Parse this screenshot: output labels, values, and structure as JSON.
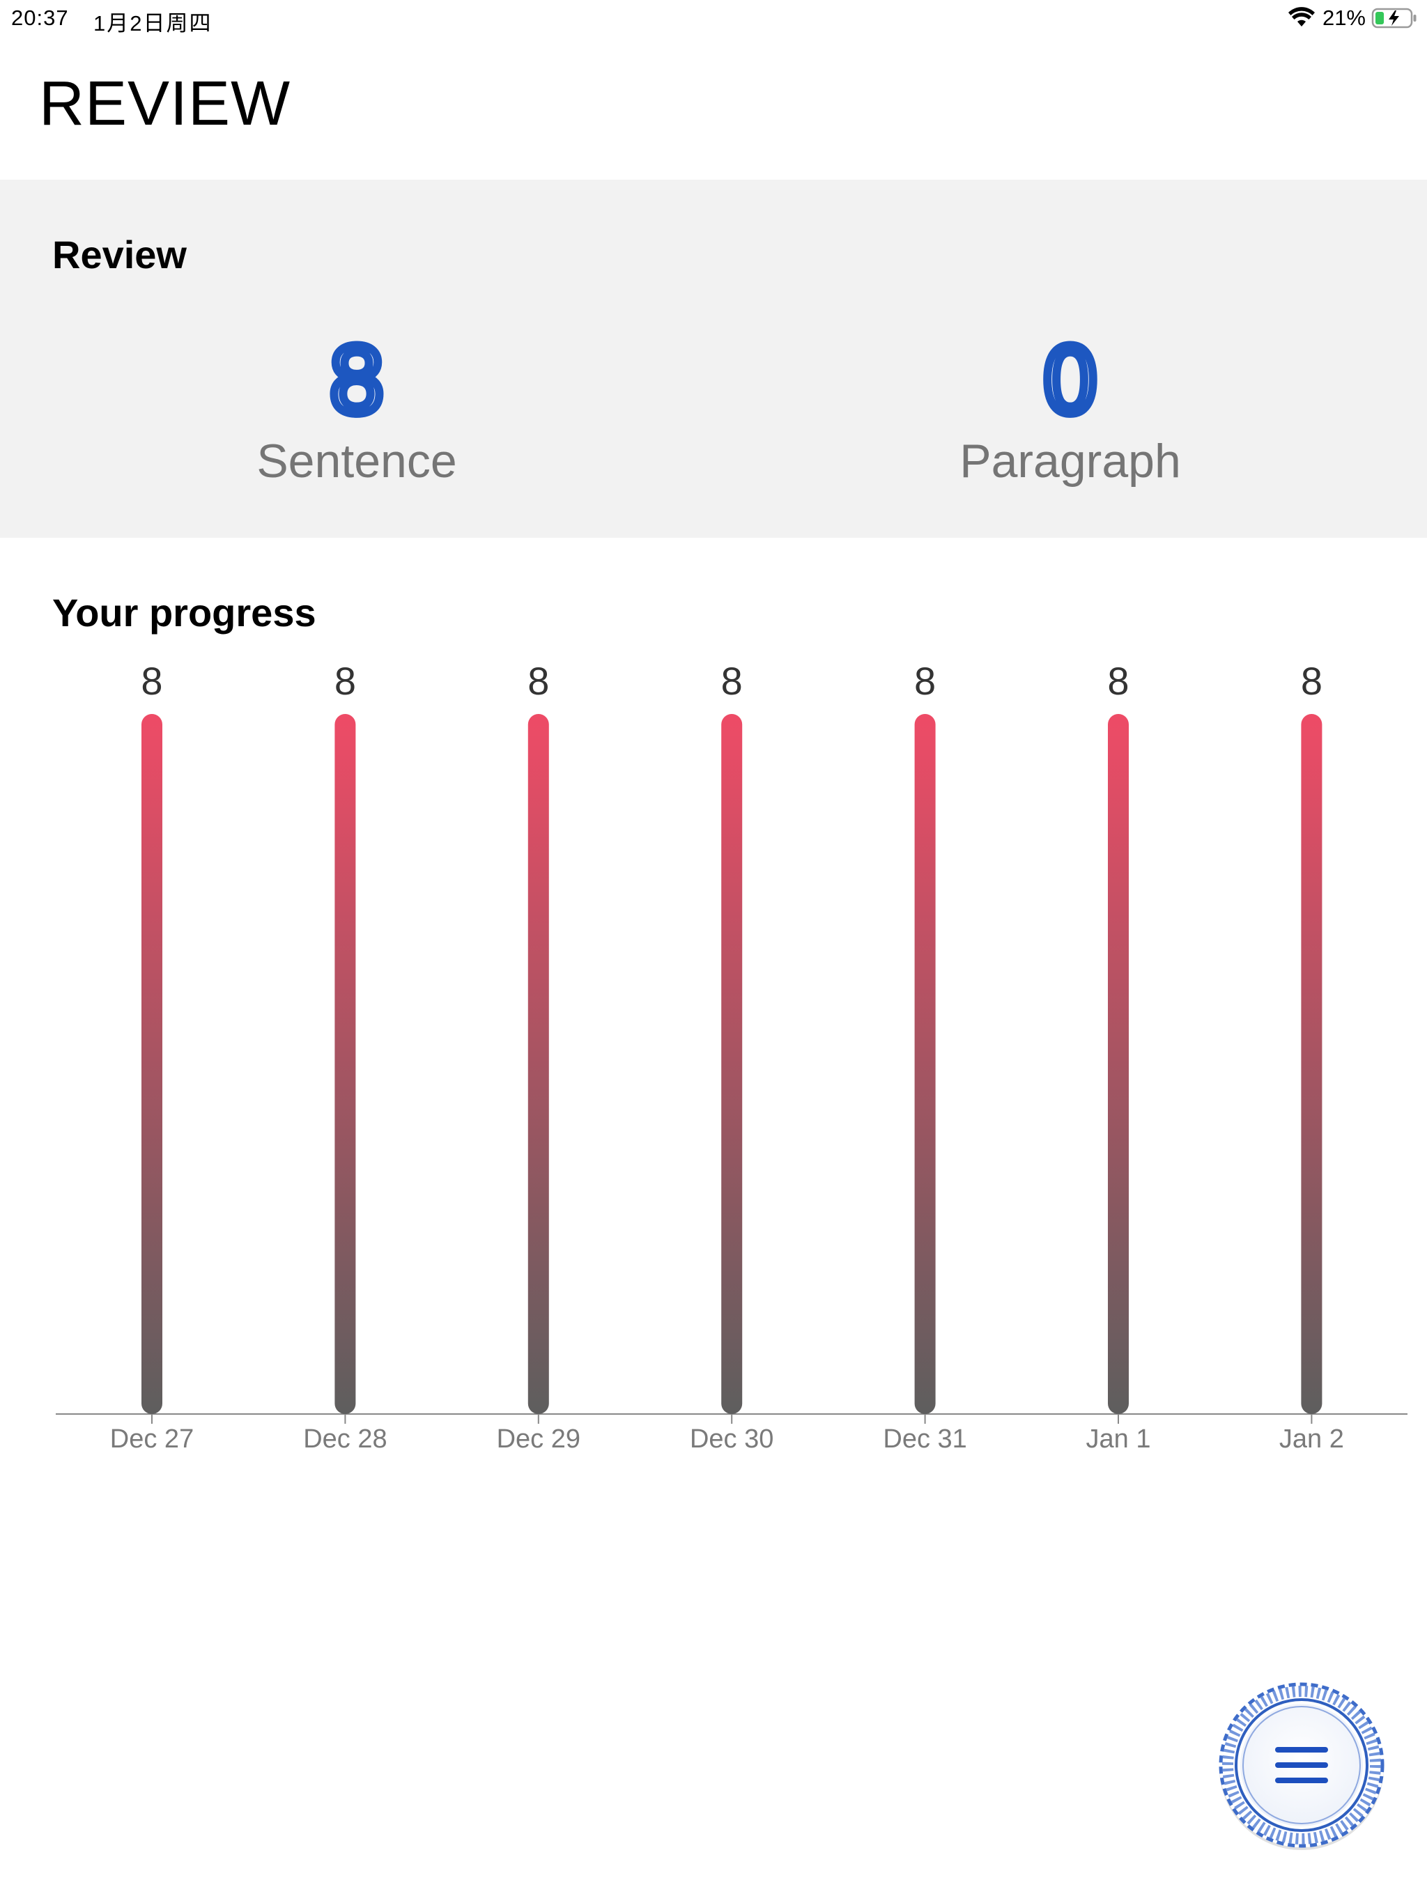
{
  "status_bar": {
    "time": "20:37",
    "date": "1月2日周四",
    "battery_percent": "21%",
    "battery_level": 0.21,
    "charging": true
  },
  "page": {
    "title": "REVIEW"
  },
  "review": {
    "heading": "Review",
    "sentence": {
      "count": "8",
      "label": "Sentence"
    },
    "paragraph": {
      "count": "0",
      "label": "Paragraph"
    }
  },
  "progress": {
    "heading": "Your progress"
  },
  "chart_data": {
    "type": "bar",
    "title": "Your progress",
    "categories": [
      "Dec 27",
      "Dec 28",
      "Dec 29",
      "Dec 30",
      "Dec 31",
      "Jan 1",
      "Jan 2"
    ],
    "values": [
      8,
      8,
      8,
      8,
      8,
      8,
      8
    ],
    "data_labels": true,
    "grid": false,
    "colors": {
      "bar_top": "#ee4b66",
      "bar_bottom": "#5e5e5e",
      "axis": "#888888",
      "tick_label": "#7a7a7a"
    }
  },
  "colors": {
    "accent": "#1d57c0",
    "panel_bg": "#f2f2f2",
    "label_grey": "#757575"
  },
  "fab": {
    "icon": "menu-icon"
  }
}
